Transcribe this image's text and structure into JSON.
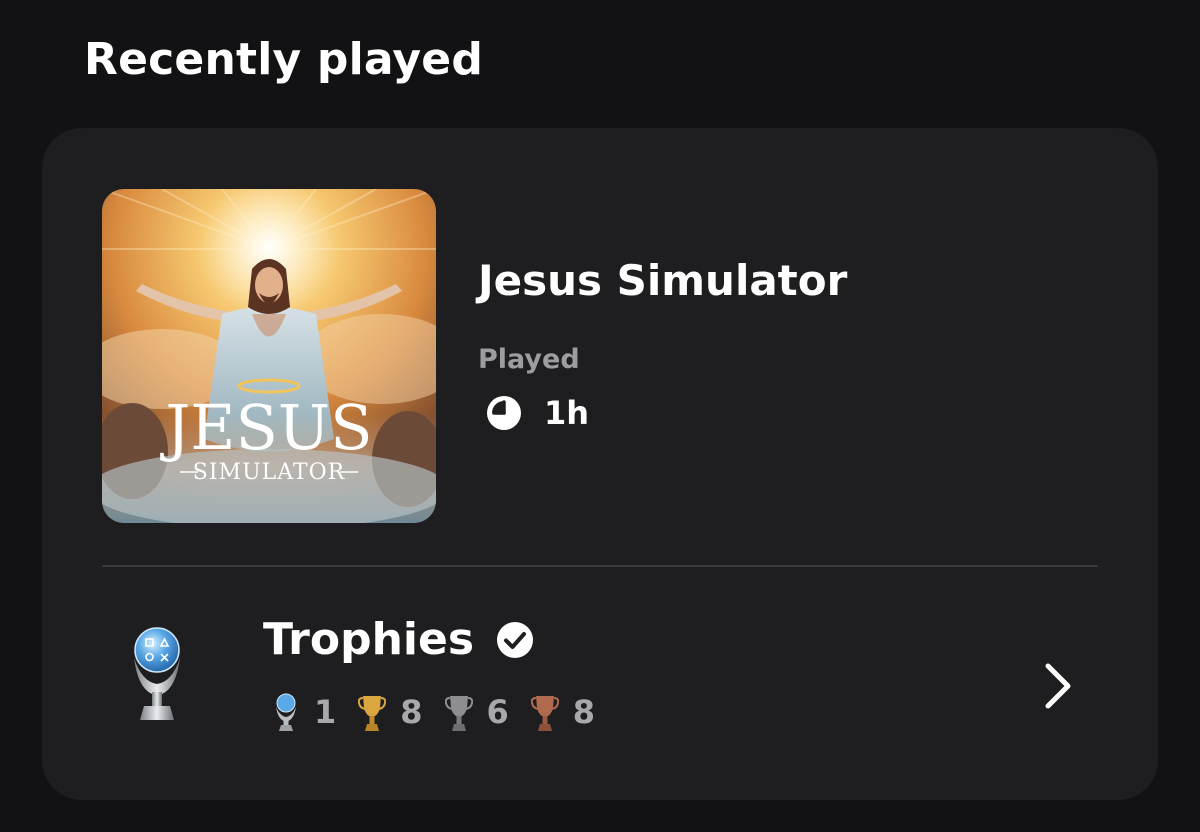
{
  "section": {
    "title": "Recently played"
  },
  "game": {
    "title": "Jesus Simulator",
    "cover_logo_line1": "JESUS",
    "cover_logo_line2": "SIMULATOR",
    "played_label": "Played",
    "playtime": "1h",
    "clock_icon": "clock-icon"
  },
  "trophies": {
    "label": "Trophies",
    "completed_icon": "check-circle-icon",
    "icon": "platinum-trophy-icon",
    "platinum": "1",
    "gold": "8",
    "silver": "6",
    "bronze": "8",
    "chevron_icon": "chevron-right-icon"
  },
  "colors": {
    "background": "#121214",
    "card": "#1e1e20",
    "muted_text": "#9d9da1",
    "gold": "#d9a640",
    "silver": "#8e8e92",
    "bronze": "#b06a4e",
    "platinum": "#6fb6ea"
  }
}
